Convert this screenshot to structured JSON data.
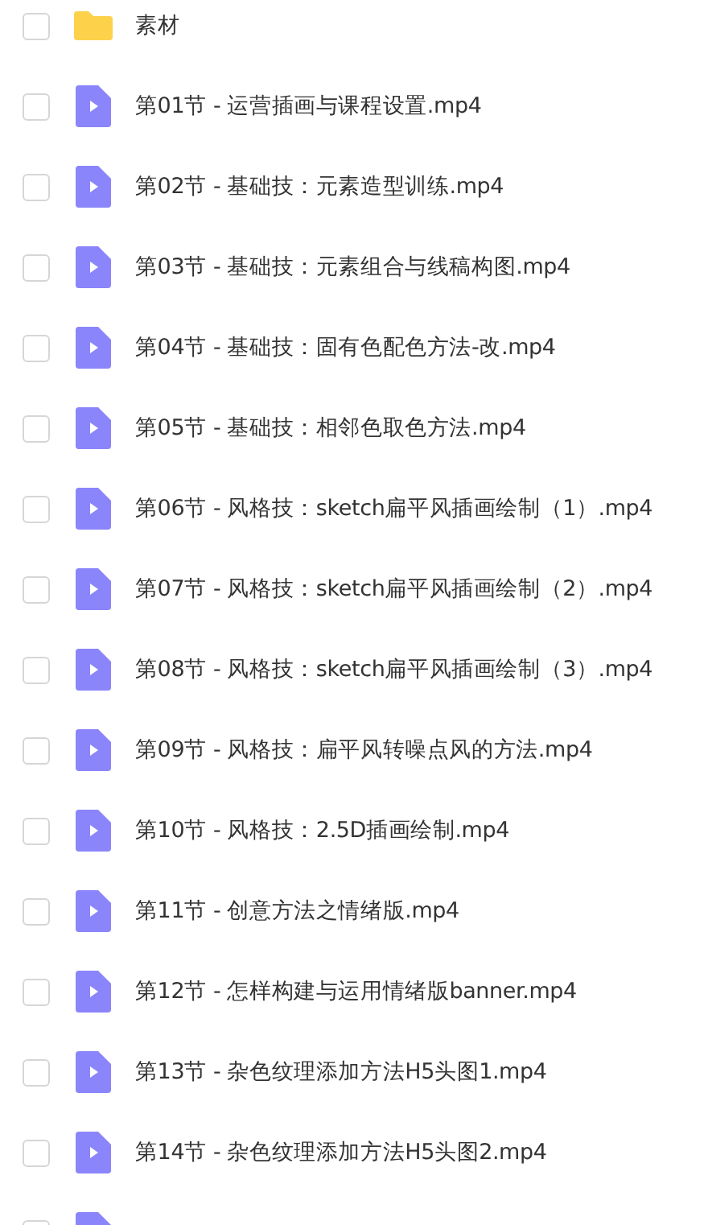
{
  "files": [
    {
      "kind": "folder",
      "name": "素材",
      "checked": false
    },
    {
      "kind": "video",
      "name": "第01节 - 运营插画与课程设置.mp4",
      "checked": false
    },
    {
      "kind": "video",
      "name": "第02节 - 基础技：元素造型训练.mp4",
      "checked": false
    },
    {
      "kind": "video",
      "name": "第03节 - 基础技：元素组合与线稿构图.mp4",
      "checked": false
    },
    {
      "kind": "video",
      "name": "第04节 - 基础技：固有色配色方法-改.mp4",
      "checked": false
    },
    {
      "kind": "video",
      "name": "第05节 - 基础技：相邻色取色方法.mp4",
      "checked": false
    },
    {
      "kind": "video",
      "name": "第06节 - 风格技：sketch扁平风插画绘制（1）.mp4",
      "checked": false
    },
    {
      "kind": "video",
      "name": "第07节 - 风格技：sketch扁平风插画绘制（2）.mp4",
      "checked": false
    },
    {
      "kind": "video",
      "name": "第08节 - 风格技：sketch扁平风插画绘制（3）.mp4",
      "checked": false
    },
    {
      "kind": "video",
      "name": "第09节 - 风格技：扁平风转噪点风的方法.mp4",
      "checked": false
    },
    {
      "kind": "video",
      "name": "第10节 - 风格技：2.5D插画绘制.mp4",
      "checked": false
    },
    {
      "kind": "video",
      "name": "第11节 - 创意方法之情绪版.mp4",
      "checked": false
    },
    {
      "kind": "video",
      "name": "第12节 - 怎样构建与运用情绪版banner.mp4",
      "checked": false
    },
    {
      "kind": "video",
      "name": "第13节 - 杂色纹理添加方法H5头图1.mp4",
      "checked": false
    },
    {
      "kind": "video",
      "name": "第14节 - 杂色纹理添加方法H5头图2.mp4",
      "checked": false
    },
    {
      "kind": "video",
      "checked": false
    }
  ]
}
